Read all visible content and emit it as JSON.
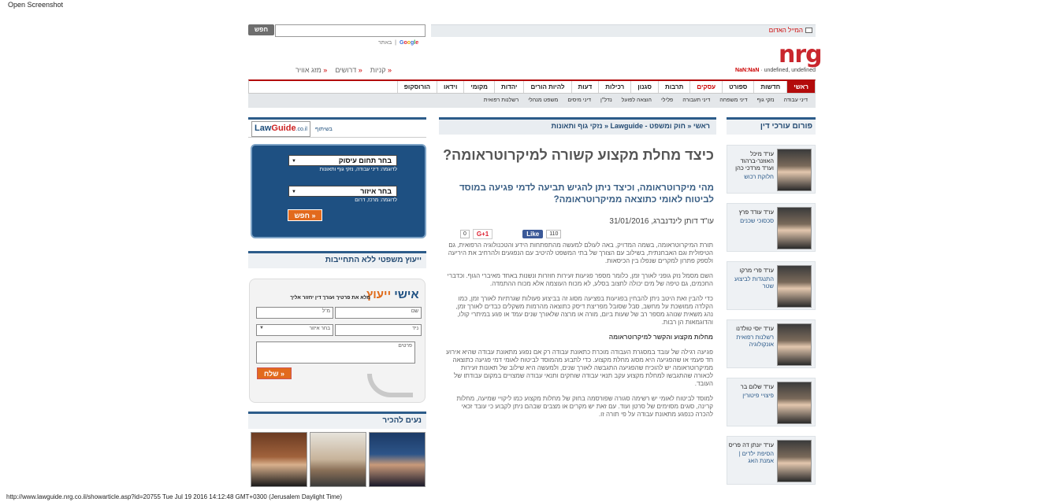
{
  "window": {
    "label": "Open Screenshot",
    "footer_url": "http://www.lawguide.nrg.co.il/showarticle.asp?id=20755 Tue Jul 19 2016 14:12:48 GMT+0300 (Jerusalem Daylight Time)"
  },
  "header": {
    "mayday": "המייל האדום",
    "search_button": "חפש",
    "google": [
      "G",
      "o",
      "o",
      "g",
      "l",
      "e"
    ],
    "site_label": "באתר",
    "logo": "nrg",
    "nan_label": "NaN:NaN",
    "undefined_text": " · undefined, undefined",
    "quick_links": [
      "קניות",
      "דרושים",
      "מזג אוויר"
    ]
  },
  "main_nav": [
    "ראשי",
    "חדשות",
    "ספורט",
    "עסקים",
    "תרבות",
    "סגנון",
    "רכילות",
    "דעות",
    "להיות הורים",
    "יהדות",
    "מקומי",
    "וידאו",
    "הורוסקופ"
  ],
  "sub_nav": [
    "דיני עבודה",
    "נזקי גוף",
    "דיני משפחה",
    "דיני תעבורה",
    "פלילי",
    "הוצאה לפועל",
    "נדל\"ן",
    "דיני מיסים",
    "משפט מנהלי",
    "רשלנות רפואית"
  ],
  "right_column": {
    "title": "פורום עורכי דין",
    "lawyers": [
      {
        "name": "עו\"ד מיכל האוזנר-ברהוד ועו\"ד מרדכי כהן",
        "spec": "חלוקת רכוש"
      },
      {
        "name": "עו\"ד עודד פרץ",
        "spec": "סכסוכי שכנים"
      },
      {
        "name": "עו\"ד פרי מרקו",
        "spec": "התנגדות לביצוע שטר"
      },
      {
        "name": "עו\"ד יוסי טולדנו",
        "spec": "רשלנות רפואית אונקולוגיה"
      },
      {
        "name": "עו\"ד שלום בר",
        "spec": "פיצויי פיטורין"
      },
      {
        "name": "עו\"ד יונתן דה פריס",
        "spec": "הסיפת ילדים | אמנת האג"
      }
    ]
  },
  "article": {
    "breadcrumb": "ראשי « חוק ומשפט - Lawguide « נזקי גוף ותאונות",
    "title": "כיצד מחלת מקצוע קשורה למיקרוטראומה?",
    "subtitle": "מהי מיקרוטראומה, וכיצד ניתן להגיש תביעה לדמי פגיעה במוסד לביטוח לאומי כתוצאה ממיקרוטראומה?",
    "author_date": "עו\"ד דותן לינדנברג, 31/01/2016",
    "fb_count": "110",
    "fb_label": "Like",
    "gplus_label": "G+1",
    "gplus_count": "0",
    "paragraphs": [
      "תורת המיקרוטראומה, בשמה המדויק, באה לעולם למעשה מהתפתחות הידע והטכנולוגיה הרפואית, גם הטיפולית וגם האבחנתית, בשילוב עם הצורך של בתי המשפט להיטיב עם הנפגעים ולהרחיב את היריעה ולספק פתרון למקרים שנפלו בין הכיסאות.",
      "השם מסמל נזק גופני לאורך זמן, כלומר מספר פגיעות זעירות חוזרות ונשנות באחד מאיברי הגוף. וכדברי החכמים, גם טיפה של מים יכולה לחצוב בסלע, לא מכוח העוצמה אלא מכוח ההתמדה.",
      "כדי להבין זאת היטב ניתן להבחין בפגיעות בפציעה מסוג זה בביצוע פעולות שגרתיות לאורך זמן, כמו הקלדה ממושכת על מחשב, סבל שסובל מפריצת דיסק כתוצאה מהרמות משקלים כבדים לאורך זמן, נהג משאית שנוהג מספר רב של שעות ביום, מורה או מרצה שלאורך שנים עמד או פגע במיתרי קולו, והדוגמאות הן רבות."
    ],
    "section_heading": "מחלות מקצוע והקשר למיקרוטראומה",
    "paragraphs2": [
      "פגיעה רגילה של עובד במסגרת העבודה מוכרת כתאונת עבודה רק אם נפגע מתאונת עבודה שהיא אירוע חד פעמי או שהפגיעה היא מסוג מחלת מקצוע. כדי לתבוע מהמוסד לביטוח לאומי דמי פגיעה כתוצאה ממיקרוטראומה יש להוכיח שהפגיעה התגבשה לאורך שנים, ולמעשה היא שילוב של תאונות זעירות לכאורה שהתגבשו למחלת מקצוע עקב תנאי עבודה שוחקים ותנאי עבודה שמצויים במקום עבודתו של העובד.",
      "למוסד לביטוח לאומי יש רשימה סגורה שפורסמה בחוק של מחלות מקצוע כמו ליקויי שמיעה, מחלות קרינה, סוגים מסוימים של סרטן ועוד. עם זאת יש מקרים או מצבים שבהם ניתן לקבוע כי עובד זכאי להכרה כנפגע מתאונת עבודה על פי תורה זו."
    ]
  },
  "left_column": {
    "lg_logo_a": "Law",
    "lg_logo_b": "Guide",
    "lg_logo_c": ".co.il",
    "lg_partner": "בשיתוף",
    "select_area": "בחר תחום עיסוק",
    "select_area_eg": "לדוגמה: דיני עבודה, נזקי גוף ותאונות",
    "select_region": "בחר איזור",
    "select_region_eg": "לדוגמה: מרכז, דרום",
    "search_button": "חפש »",
    "advice_title": "ייעוץ משפטי ללא התחייבות",
    "advice_logo_a": "ייעוץ ",
    "advice_logo_b": "אישי",
    "advice_tag": "מלא את פרטיך ועורך דין יחזור אליך",
    "field_name": "שם",
    "field_email": "מ\"ל",
    "field_phone": "ניד",
    "field_region": "בחר איזור",
    "field_details": "פרטים",
    "send_button": "שלח »",
    "nice_title": "נעים להכיר"
  }
}
